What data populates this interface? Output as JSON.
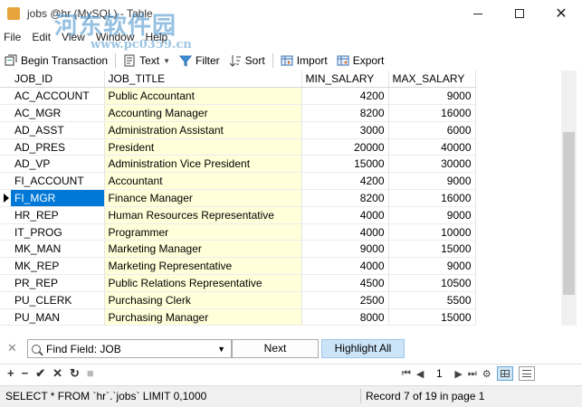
{
  "window": {
    "title": "jobs @hr (MySQL) - Table",
    "watermark": "河东软件园",
    "watermark_url": "www.pc0359.cn"
  },
  "menu": [
    "File",
    "Edit",
    "View",
    "Window",
    "Help"
  ],
  "toolbar": {
    "begin_transaction": "Begin Transaction",
    "text": "Text",
    "filter": "Filter",
    "sort": "Sort",
    "import": "Import",
    "export": "Export"
  },
  "grid": {
    "columns": [
      "JOB_ID",
      "JOB_TITLE",
      "MIN_SALARY",
      "MAX_SALARY"
    ],
    "selected_row": 6,
    "rows": [
      [
        "AC_ACCOUNT",
        "Public Accountant",
        "4200",
        "9000"
      ],
      [
        "AC_MGR",
        "Accounting Manager",
        "8200",
        "16000"
      ],
      [
        "AD_ASST",
        "Administration Assistant",
        "3000",
        "6000"
      ],
      [
        "AD_PRES",
        "President",
        "20000",
        "40000"
      ],
      [
        "AD_VP",
        "Administration Vice President",
        "15000",
        "30000"
      ],
      [
        "FI_ACCOUNT",
        "Accountant",
        "4200",
        "9000"
      ],
      [
        "FI_MGR",
        "Finance Manager",
        "8200",
        "16000"
      ],
      [
        "HR_REP",
        "Human Resources Representative",
        "4000",
        "9000"
      ],
      [
        "IT_PROG",
        "Programmer",
        "4000",
        "10000"
      ],
      [
        "MK_MAN",
        "Marketing Manager",
        "9000",
        "15000"
      ],
      [
        "MK_REP",
        "Marketing Representative",
        "4000",
        "9000"
      ],
      [
        "PR_REP",
        "Public Relations Representative",
        "4500",
        "10500"
      ],
      [
        "PU_CLERK",
        "Purchasing Clerk",
        "2500",
        "5500"
      ],
      [
        "PU_MAN",
        "Purchasing Manager",
        "8000",
        "15000"
      ]
    ]
  },
  "find": {
    "value": "Find Field: JOB",
    "next_label": "Next",
    "highlight_label": "Highlight All"
  },
  "nav": {
    "page": "1"
  },
  "status": {
    "sql": "SELECT * FROM `hr`.`jobs` LIMIT 0,1000",
    "record": "Record 7 of 19 in page 1"
  },
  "colors": {
    "selection": "#0078d7",
    "title_column_bg": "#ffffd9",
    "highlight_button": "#cce4f7"
  }
}
